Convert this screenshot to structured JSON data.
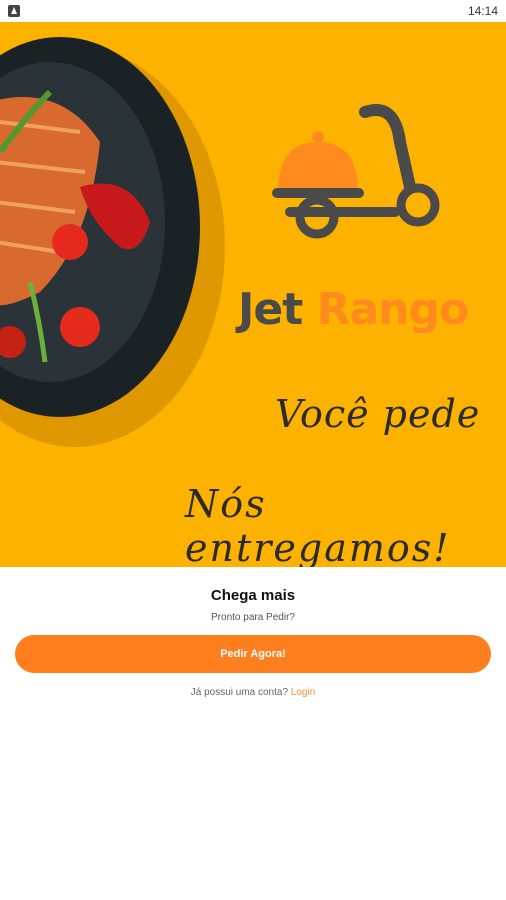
{
  "status_bar": {
    "time": "14:14"
  },
  "hero": {
    "brand_part1": "Jet",
    "brand_part2": "Rango",
    "tagline_line1": "Você pede",
    "tagline_line2": "Nós entregamos!",
    "colors": {
      "background": "#fdb200",
      "brand_dark": "#4a4a4a",
      "brand_orange": "#ff8a1e"
    }
  },
  "main": {
    "title": "Chega mais",
    "subtitle": "Pronto para Pedir?",
    "cta_label": "Pedir Agora!",
    "login_prompt": "Já possui uma conta?",
    "login_link": "Login",
    "colors": {
      "button": "#ff7f1f",
      "link": "#ff8a2d"
    }
  }
}
